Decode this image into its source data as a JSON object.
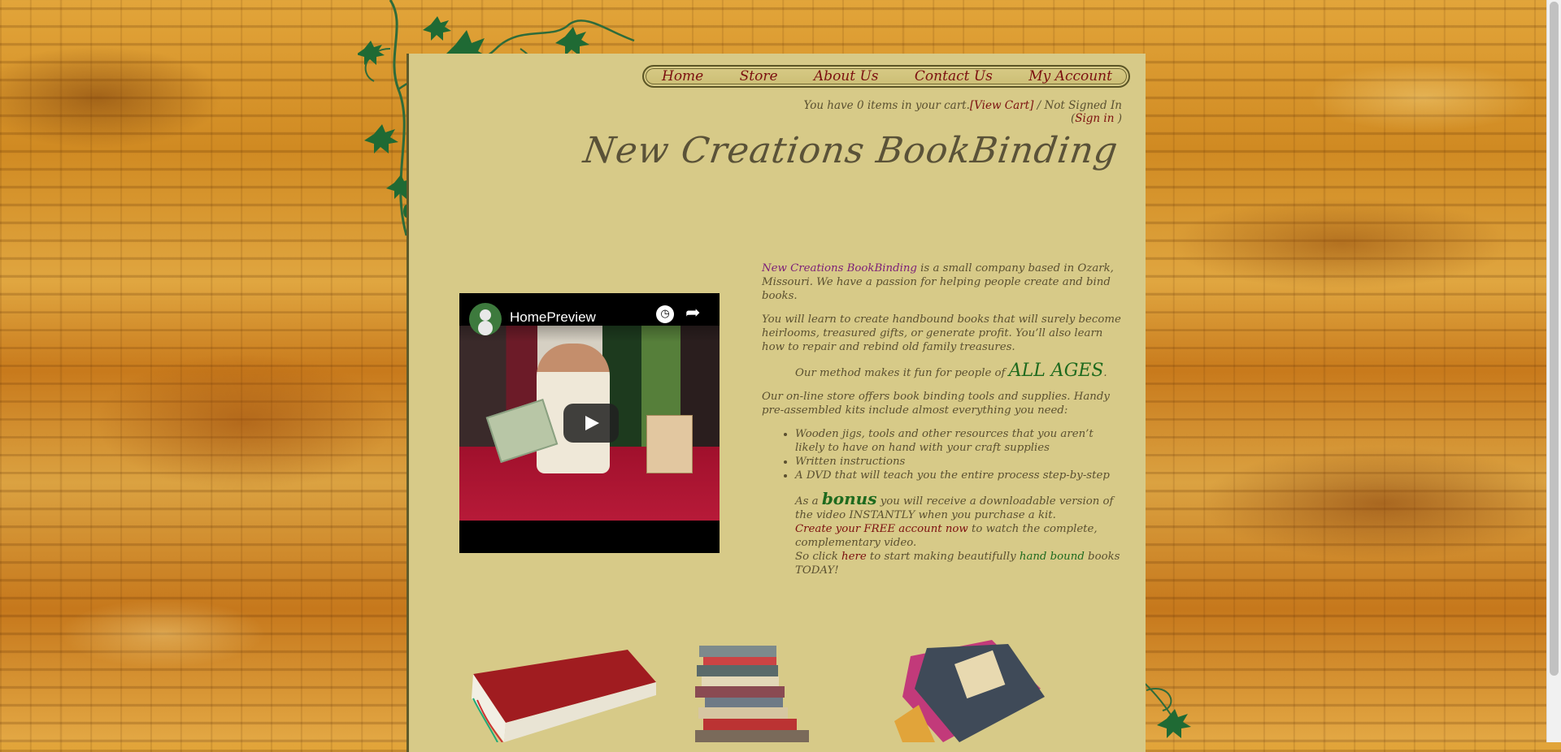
{
  "nav": {
    "items": [
      {
        "label": "Home"
      },
      {
        "label": "Store"
      },
      {
        "label": "About Us"
      },
      {
        "label": "Contact Us"
      },
      {
        "label": "My Account"
      }
    ]
  },
  "cart": {
    "prefix": "You have 0 items in your cart.",
    "view_cart": "[View Cart]",
    "separator": " / ",
    "signin_status": "Not Signed In (",
    "signin_link": "Sign in",
    "signin_close": " )"
  },
  "site_title": "New Creations BookBinding",
  "video": {
    "title": "HomePreview"
  },
  "content": {
    "p1_brand": "New Creations BookBinding",
    "p1_rest": " is a small company based in Ozark, Missouri. We have a passion for helping people create and bind books.",
    "p2": "You will learn to create handbound books that will surely become heirlooms, treasured gifts, or generate profit. You’ll also learn how to repair and rebind old family treasures.",
    "p3_prefix": "Our method makes it fun for people of ",
    "p3_emph": "ALL AGES",
    "p3_suffix": ".",
    "p4": "Our on-line store offers book binding tools and supplies. Handy pre-assembled kits include almost everything you need:",
    "list": [
      "Wooden jigs, tools and other resources that you aren’t likely to have on hand with your craft supplies",
      "Written instructions",
      "A DVD that will teach you the entire process step-by-step"
    ],
    "bonus_prefix": "As a ",
    "bonus_word": "bonus",
    "bonus_rest": " you will receive a downloadable version of the video INSTANTLY when you purchase a kit.",
    "account_link": "Create your FREE account now",
    "account_rest": " to watch the complete, complementary video.",
    "click_prefix": "So click ",
    "click_link": "here",
    "click_middle": "  to start making beautifully ",
    "click_green": "hand bound",
    "click_suffix": " books TODAY!"
  },
  "colors": {
    "page_bg": "#d7ca88",
    "nav_link": "#7b0f0f",
    "brand": "#7b1e78",
    "accent_green": "#1e6a1e",
    "body_text": "#5b5030"
  }
}
